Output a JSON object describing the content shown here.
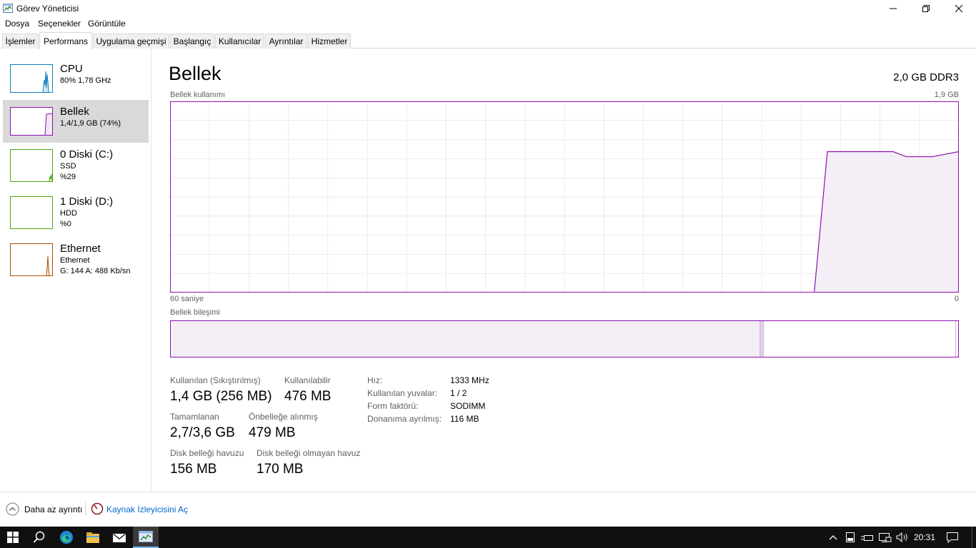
{
  "window": {
    "title": "Görev Yöneticisi",
    "controls": [
      "minimize",
      "restore",
      "close"
    ]
  },
  "menu": [
    "Dosya",
    "Seçenekler",
    "Görüntüle"
  ],
  "tabs": [
    "İşlemler",
    "Performans",
    "Uygulama geçmişi",
    "Başlangıç",
    "Kullanıcılar",
    "Ayrıntılar",
    "Hizmetler"
  ],
  "active_tab": "Performans",
  "sidebar": [
    {
      "title": "CPU",
      "line1": "80%  1,78 GHz",
      "line2": "",
      "color": "#117dbb"
    },
    {
      "title": "Bellek",
      "line1": "1,4/1,9 GB (74%)",
      "line2": "",
      "color": "#8b12ae"
    },
    {
      "title": "0 Diski (C:)",
      "line1": "SSD",
      "line2": "%29",
      "color": "#4da60c"
    },
    {
      "title": "1 Diski (D:)",
      "line1": "HDD",
      "line2": "%0",
      "color": "#4da60c"
    },
    {
      "title": "Ethernet",
      "line1": "Ethernet",
      "line2": "G: 144  A: 488 Kb/sn",
      "color": "#a74f01"
    }
  ],
  "panel": {
    "title": "Bellek",
    "spec": "2,0 GB DDR3",
    "usage_label": "Bellek kullanımı",
    "usage_max": "1,9 GB",
    "time_left": "60 saniye",
    "time_right": "0",
    "composition_label": "Bellek bileşimi",
    "accent": "#8b12ae"
  },
  "chart_data": {
    "type": "area",
    "title": "Bellek kullanımı",
    "xlabel": "60 saniye",
    "ylabel": "",
    "xlim": [
      60,
      0
    ],
    "ylim": [
      0,
      1.9
    ],
    "grid": true,
    "series": [
      {
        "x": [
          60,
          11,
          10,
          8,
          5,
          4,
          2,
          0
        ],
        "values": [
          0.0,
          0.0,
          1.4,
          1.4,
          1.4,
          1.35,
          1.35,
          1.4
        ]
      }
    ],
    "composition": {
      "in_use_fraction": 0.748,
      "modified_fraction": 0.004,
      "standby_fraction": 0.244,
      "free_fraction": 0.004
    }
  },
  "stats": [
    {
      "label": "Kullanılan (Sıkıştırılmış)",
      "value": "1,4 GB (256 MB)"
    },
    {
      "label": "Kullanılabilir",
      "value": "476 MB"
    },
    {
      "label": "Tamamlanan",
      "value": "2,7/3,6 GB"
    },
    {
      "label": "Önbelleğe alınmış",
      "value": "479 MB"
    },
    {
      "label": "Disk belleği havuzu",
      "value": "156 MB"
    },
    {
      "label": "Disk belleği olmayan havuz",
      "value": "170 MB"
    }
  ],
  "properties": [
    {
      "label": "Hız:",
      "value": "1333 MHz"
    },
    {
      "label": "Kullanılan yuvalar:",
      "value": "1 / 2"
    },
    {
      "label": "Form faktörü:",
      "value": "SODIMM"
    },
    {
      "label": "Donanıma ayrılmış:",
      "value": "116 MB"
    }
  ],
  "footer": {
    "fewer_details": "Daha az ayrıntı",
    "resource_monitor": "Kaynak İzleyicisini Aç",
    "link_color": "#0066cc"
  },
  "taskbar": {
    "icons": [
      "windows-start-icon",
      "search-icon",
      "edge-icon",
      "file-explorer-icon",
      "mail-icon",
      "task-manager-icon"
    ],
    "tray_icons": [
      "chevron-up-icon",
      "tablet-icon",
      "power-icon",
      "network-icon",
      "volume-icon"
    ],
    "clock": "20:31"
  }
}
